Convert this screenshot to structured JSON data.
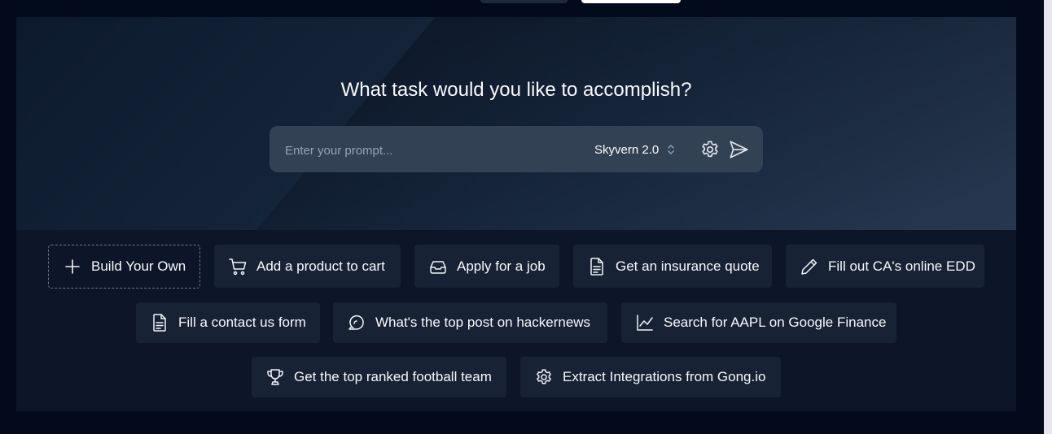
{
  "hero": {
    "title": "What task would you like to accomplish?",
    "prompt_placeholder": "Enter your prompt...",
    "model": "Skyvern 2.0"
  },
  "suggestions": [
    {
      "label": "Build Your Own",
      "icon": "plus-icon"
    },
    {
      "label": "Add a product to cart",
      "icon": "cart-icon"
    },
    {
      "label": "Apply for a job",
      "icon": "inbox-icon"
    },
    {
      "label": "Get an insurance quote",
      "icon": "file-text-icon"
    },
    {
      "label": "Fill out CA's online EDD",
      "icon": "pencil-icon"
    },
    {
      "label": "Fill a contact us form",
      "icon": "file-text-icon"
    },
    {
      "label": "What's the top post on hackernews",
      "icon": "chat-bubble-icon"
    },
    {
      "label": "Search for AAPL on Google Finance",
      "icon": "line-chart-icon"
    },
    {
      "label": "Get the top ranked football team",
      "icon": "trophy-icon"
    },
    {
      "label": "Extract Integrations from Gong.io",
      "icon": "gear-icon"
    }
  ]
}
